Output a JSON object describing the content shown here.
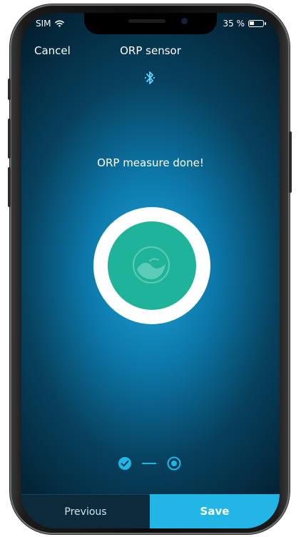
{
  "status_bar": {
    "carrier": "SIM",
    "battery_text": "35 %",
    "battery_level": 0.35,
    "icons": [
      "wifi-icon",
      "battery-icon"
    ]
  },
  "header": {
    "cancel_label": "Cancel",
    "title": "ORP sensor",
    "connection_icon": "bluetooth-icon"
  },
  "main": {
    "message": "ORP measure done!",
    "sensor_icon": "water-wave-icon"
  },
  "steps": {
    "total": 2,
    "current": 2,
    "icons": [
      "check-circle-icon",
      "radio-selected-icon"
    ]
  },
  "footer": {
    "previous_label": "Previous",
    "save_label": "Save"
  },
  "colors": {
    "accent": "#22b6e6",
    "sensor_teal": "#1fb39a",
    "background_center": "#1ea3d8",
    "background_edge": "#031d2d"
  }
}
